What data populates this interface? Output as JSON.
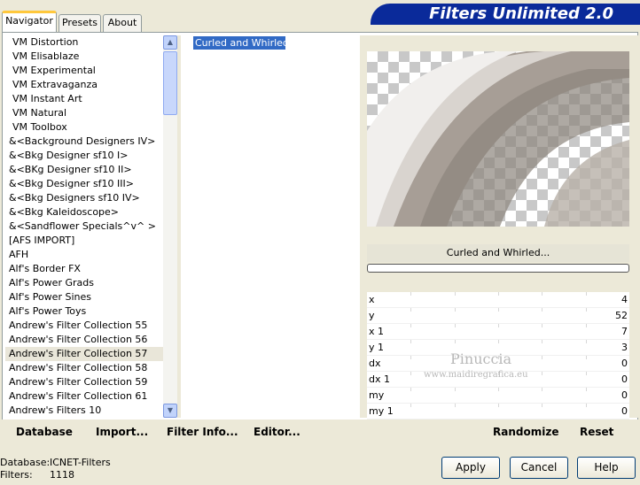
{
  "tabs": [
    "Navigator",
    "Presets",
    "About"
  ],
  "banner": "Filters Unlimited 2.0",
  "categories": [
    "VM Distortion",
    "VM Elisablaze",
    "VM Experimental",
    "VM Extravaganza",
    "VM Instant Art",
    "VM Natural",
    "VM Toolbox",
    "&<Background Designers IV>",
    "&<Bkg Designer sf10 I>",
    "&<BKg Designer sf10 II>",
    "&<Bkg Designer sf10 III>",
    "&<Bkg Designers sf10 IV>",
    "&<Bkg Kaleidoscope>",
    "&<Sandflower Specials^v^ >",
    "[AFS IMPORT]",
    "AFH",
    "Alf's Border FX",
    "Alf's Power Grads",
    "Alf's Power Sines",
    "Alf's Power Toys",
    "Andrew's Filter Collection 55",
    "Andrew's Filter Collection 56",
    "Andrew's Filter Collection 57",
    "Andrew's Filter Collection 58",
    "Andrew's Filter Collection 59",
    "Andrew's Filter Collection 61",
    "Andrew's Filters 10"
  ],
  "selected_category": "Andrew's Filter Collection 57",
  "filters": [
    "Curled and Whirled..."
  ],
  "filter_name": "Curled and Whirled...",
  "params": [
    {
      "label": "x",
      "value": "4"
    },
    {
      "label": "y",
      "value": "52"
    },
    {
      "label": "x 1",
      "value": "7"
    },
    {
      "label": "y 1",
      "value": "3"
    },
    {
      "label": "dx",
      "value": "0"
    },
    {
      "label": "dx 1",
      "value": "0"
    },
    {
      "label": "my",
      "value": "0"
    },
    {
      "label": "my 1",
      "value": "0"
    }
  ],
  "watermark": "Pinuccia",
  "watermark_url": "www.maidiregrafica.eu",
  "buttons_left": [
    "Database",
    "Import...",
    "Filter Info...",
    "Editor..."
  ],
  "buttons_right": [
    "Randomize",
    "Reset"
  ],
  "status": {
    "db_label": "Database:",
    "db_value": "ICNET-Filters",
    "filters_label": "Filters:",
    "filters_value": "1118"
  },
  "actions": [
    "Apply",
    "Cancel",
    "Help"
  ],
  "colors": {
    "banner": "#0a2a9a",
    "selection": "#316ac5",
    "tab_accent": "#ffc83c"
  },
  "icons": [
    "scroll-up-icon",
    "scroll-down-icon"
  ]
}
